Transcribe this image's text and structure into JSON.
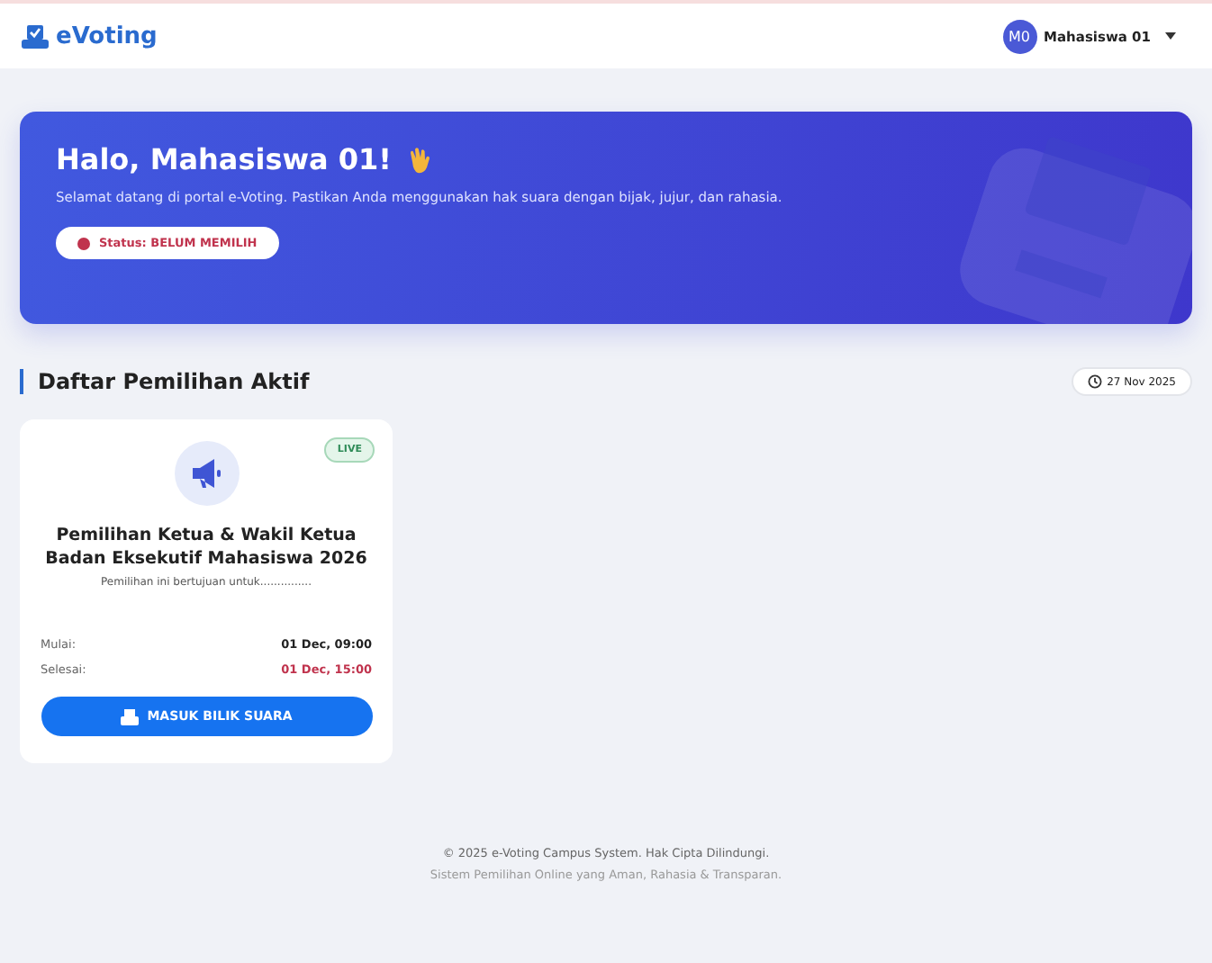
{
  "navbar": {
    "brand": "eVoting",
    "user": {
      "initials": "M0",
      "name": "Mahasiswa 01"
    }
  },
  "hero": {
    "greeting": "Halo, Mahasiswa 01!",
    "message": "Selamat datang di portal e-Voting. Pastikan Anda menggunakan hak suara dengan bijak, jujur, dan rahasia.",
    "status": {
      "label": "Status: BELUM MEMILIH",
      "color": "#c0334d"
    }
  },
  "section": {
    "title": "Daftar Pemilihan Aktif",
    "date": "27 Nov 2025"
  },
  "elections": [
    {
      "badge": "LIVE",
      "live": true,
      "title": "Pemilihan Ketua & Wakil Ketua Badan Eksekutif Mahasiswa 2026",
      "description": "Pemilihan ini bertujuan untuk...............",
      "start_label": "Mulai:",
      "start": "01 Dec, 09:00",
      "end_label": "Selesai:",
      "end": "01 Dec, 15:00",
      "button": "MASUK BILIK SUARA"
    }
  ],
  "footer": {
    "copyright": "© 2025 e-Voting Campus System. Hak Cipta Dilindungi.",
    "tagline": "Sistem Pemilihan Online yang Aman, Rahasia & Transparan."
  }
}
